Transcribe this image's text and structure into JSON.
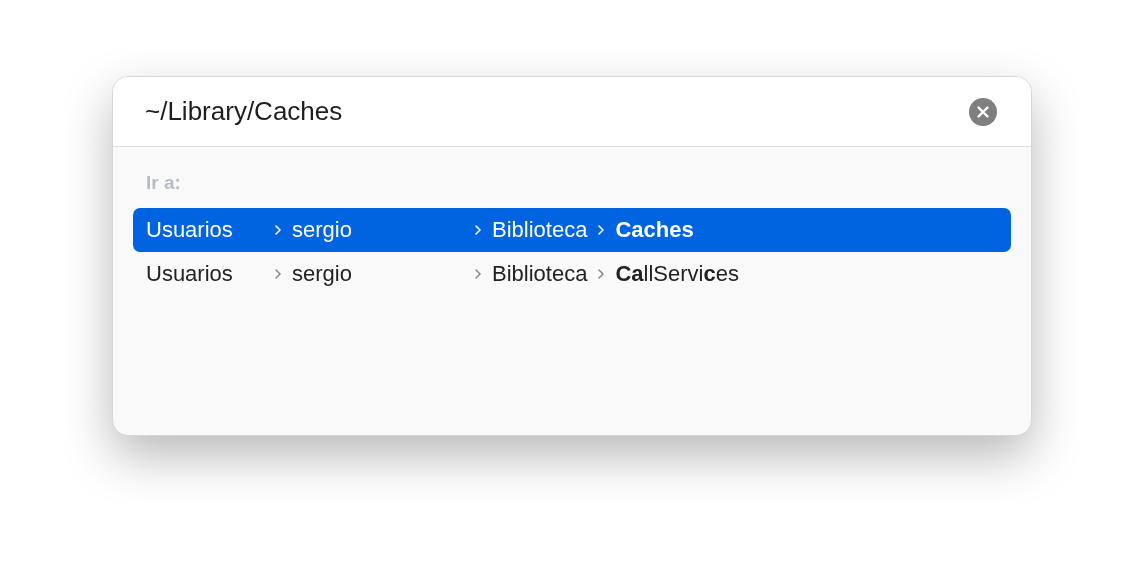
{
  "search": {
    "value": "~/Library/Caches"
  },
  "section_label": "Ir a:",
  "results": [
    {
      "selected": true,
      "path": [
        "Usuarios",
        "sergio",
        "Biblioteca"
      ],
      "last": {
        "text": "Caches",
        "bold": true
      }
    },
    {
      "selected": false,
      "path": [
        "Usuarios",
        "sergio",
        "Biblioteca"
      ],
      "last": {
        "text": "**Ca**llServi**c**es",
        "bold": false
      }
    }
  ]
}
